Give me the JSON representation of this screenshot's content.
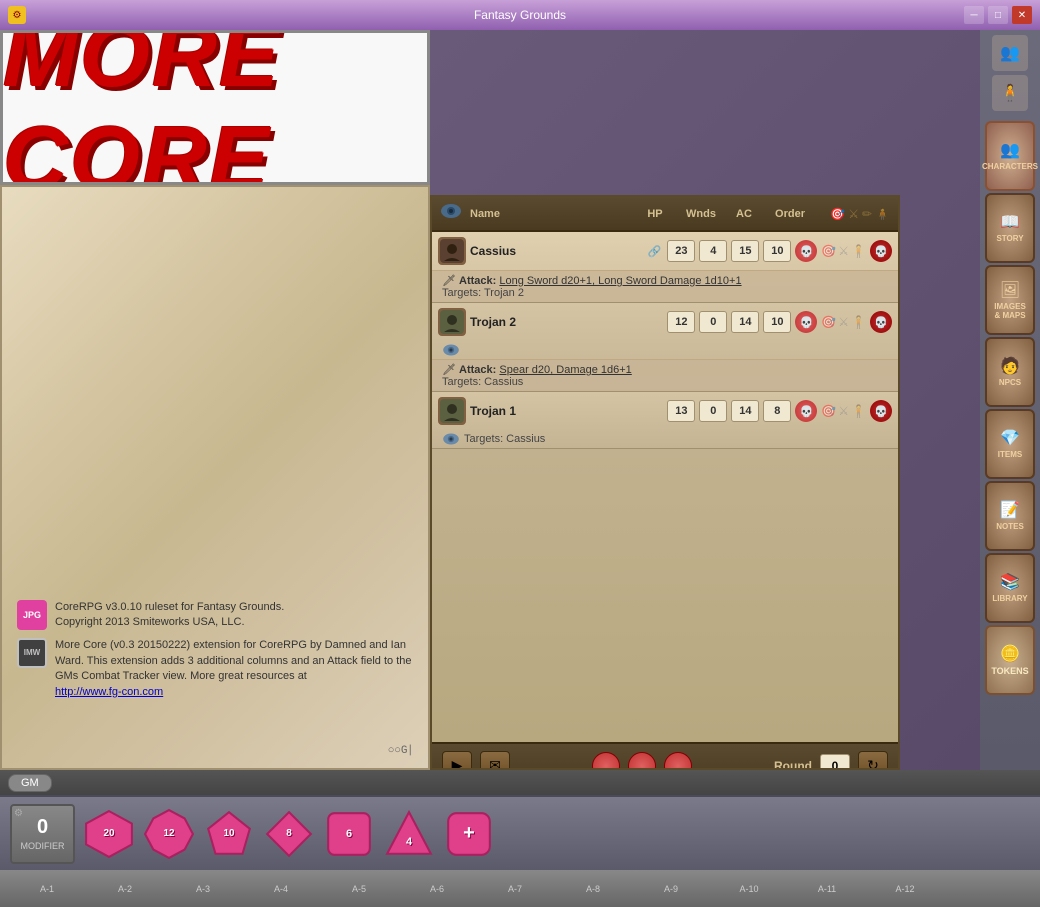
{
  "window": {
    "title": "Fantasy Grounds",
    "icon": "⚙"
  },
  "banner": {
    "text": "More Core"
  },
  "info": {
    "jpg_badge": "JPG",
    "imw_badge": "IMW",
    "line1": "CoreRPG v3.0.10 ruleset for Fantasy Grounds.\nCopyright 2013 Smiteworks USA, LLC.",
    "line2": "More Core (v0.3 20150222) extension for CoreRPG by Damned and Ian Ward. This extension adds 3 additional columns and an Attack field to the GMs Combat Tracker view. More great resources at",
    "link": "http://www.fg-con.com"
  },
  "combat_tracker": {
    "columns": {
      "name": "Name",
      "hp": "HP",
      "wnds": "Wnds",
      "ac": "AC",
      "order": "Order"
    },
    "rows": [
      {
        "name": "Cassius",
        "hp": "23",
        "wnds": "4",
        "ac": "15",
        "order": "10",
        "attack_label": "Attack:",
        "attack_detail": "Long Sword d20+1, Long Sword Damage 1d10+1",
        "targets": "Targets: Trojan 2",
        "has_detail": true
      },
      {
        "name": "Trojan 2",
        "hp": "12",
        "wnds": "0",
        "ac": "14",
        "order": "10",
        "attack_label": "Attack:",
        "attack_detail": "Spear d20, Damage 1d6+1",
        "targets": "Targets: Cassius",
        "has_detail": true
      },
      {
        "name": "Trojan 1",
        "hp": "13",
        "wnds": "0",
        "ac": "14",
        "order": "8",
        "targets": "Targets: Cassius",
        "has_detail": false
      }
    ],
    "round_label": "Round",
    "round_value": "0"
  },
  "sidebar": {
    "items": [
      {
        "label": "Characters",
        "icon": "👥"
      },
      {
        "label": "Story",
        "icon": "📖"
      },
      {
        "label": "Images\n& Maps",
        "icon": "🖼"
      },
      {
        "label": "NPCs",
        "icon": "🧑"
      },
      {
        "label": "Items",
        "icon": "💎"
      },
      {
        "label": "Notes",
        "icon": "📝"
      },
      {
        "label": "Library",
        "icon": "📚"
      },
      {
        "label": "ToKENS",
        "icon": "🪙"
      }
    ],
    "top_icons": [
      "👥",
      "🧍"
    ]
  },
  "gm_bar": {
    "gm_label": "GM"
  },
  "modifier": {
    "value": "0",
    "label": "Modifier"
  },
  "dice": [
    {
      "sides": "d20",
      "label": "20"
    },
    {
      "sides": "d12",
      "label": "12"
    },
    {
      "sides": "d10",
      "label": "10"
    },
    {
      "sides": "d8",
      "label": "8"
    },
    {
      "sides": "d6",
      "label": "6"
    },
    {
      "sides": "d4",
      "label": "4"
    },
    {
      "sides": "plus",
      "label": "+"
    }
  ],
  "bottom_labels": [
    "A-1",
    "A-2",
    "A-3",
    "A-4",
    "A-5",
    "A-6",
    "A-7",
    "A-8",
    "A-9",
    "A-10",
    "A-11",
    "A-12"
  ]
}
